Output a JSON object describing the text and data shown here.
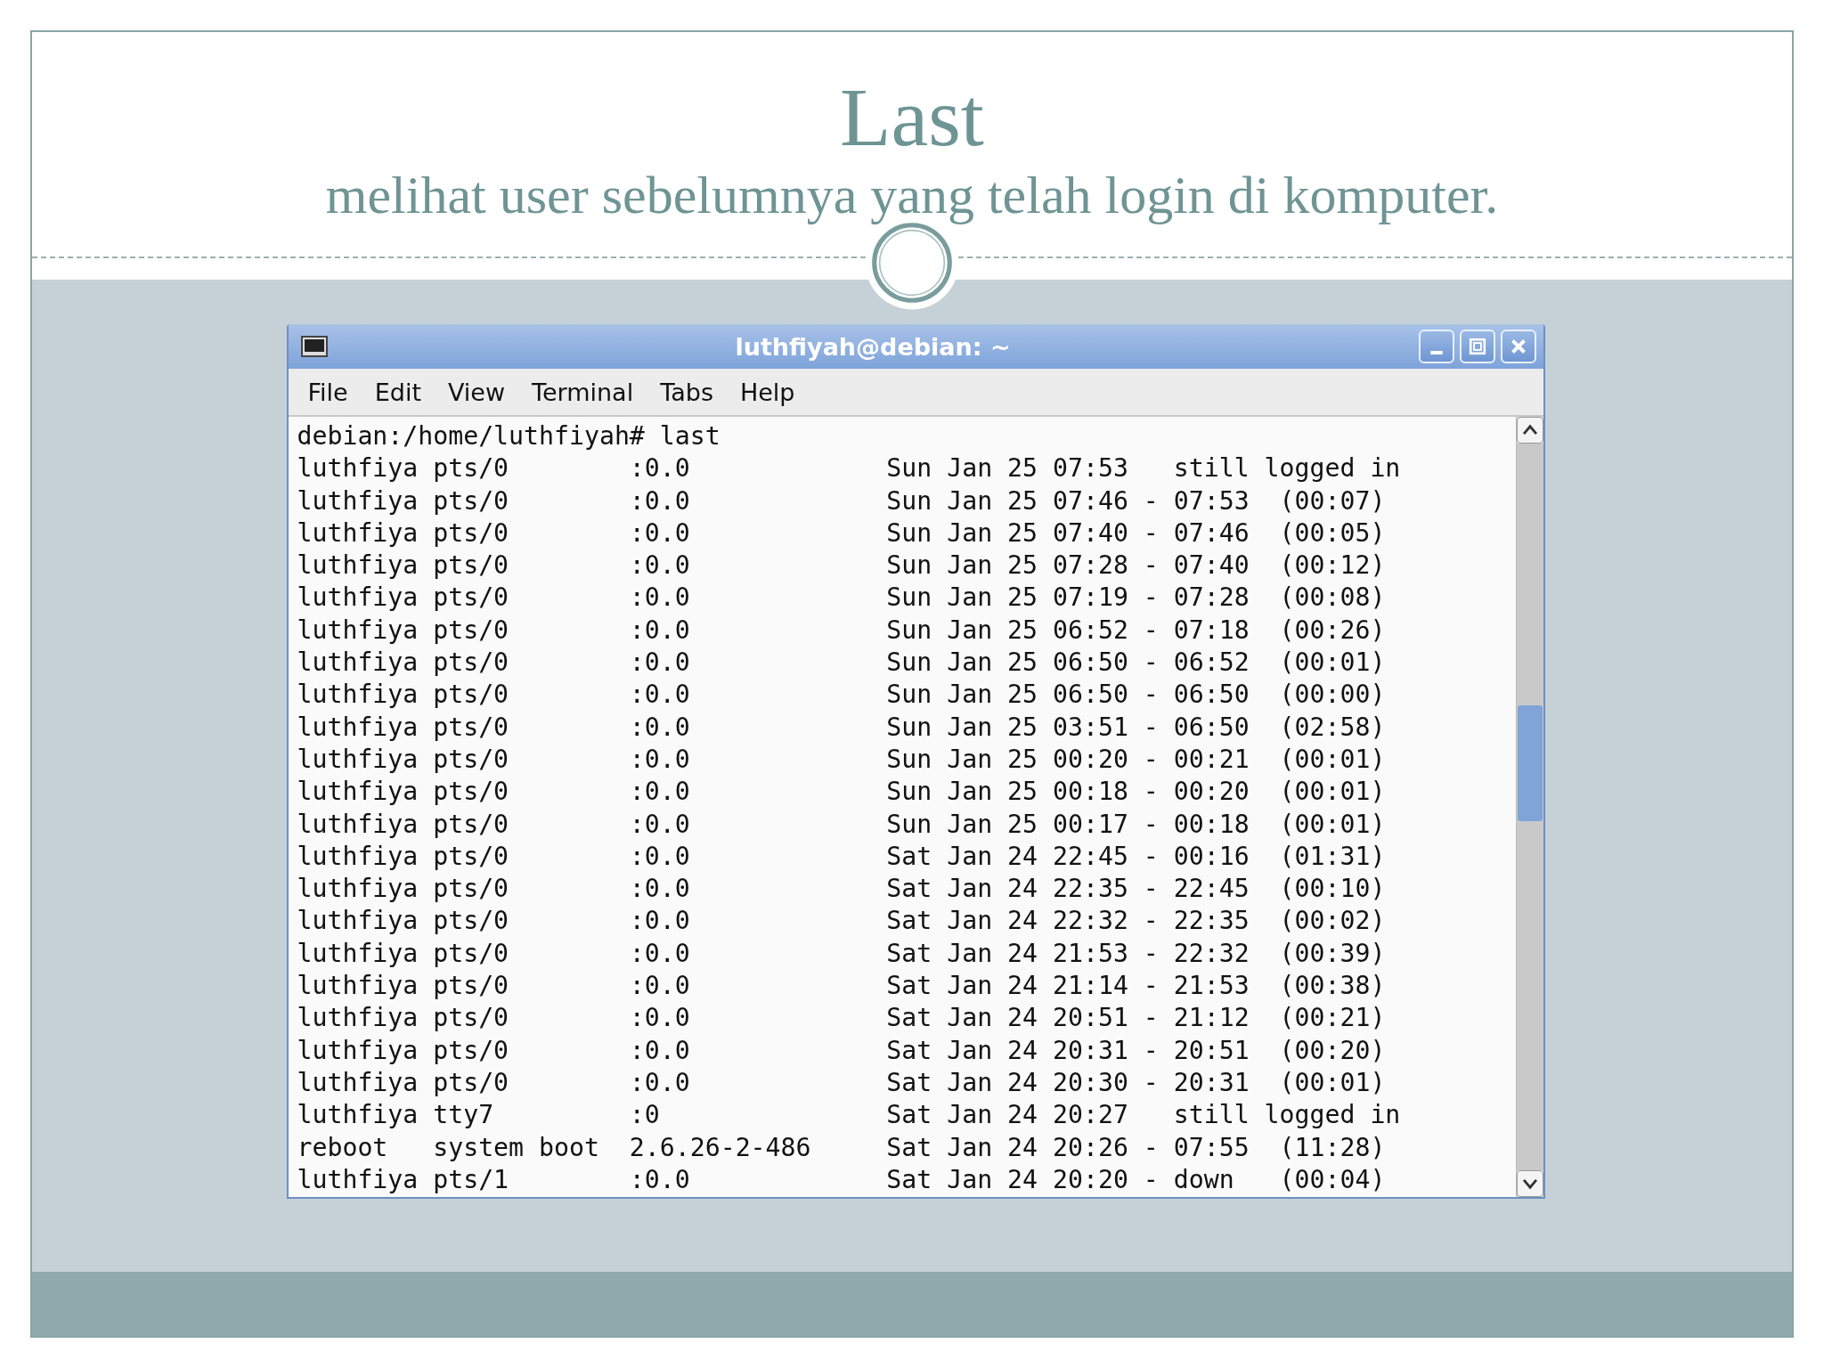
{
  "slide": {
    "title": "Last",
    "subtitle": "melihat user sebelumnya yang telah login di komputer."
  },
  "window": {
    "title": "luthfiyah@debian: ~"
  },
  "menu": [
    "File",
    "Edit",
    "View",
    "Terminal",
    "Tabs",
    "Help"
  ],
  "terminal_lines": [
    "debian:/home/luthfiyah# last",
    "luthfiya pts/0        :0.0             Sun Jan 25 07:53   still logged in",
    "luthfiya pts/0        :0.0             Sun Jan 25 07:46 - 07:53  (00:07)",
    "luthfiya pts/0        :0.0             Sun Jan 25 07:40 - 07:46  (00:05)",
    "luthfiya pts/0        :0.0             Sun Jan 25 07:28 - 07:40  (00:12)",
    "luthfiya pts/0        :0.0             Sun Jan 25 07:19 - 07:28  (00:08)",
    "luthfiya pts/0        :0.0             Sun Jan 25 06:52 - 07:18  (00:26)",
    "luthfiya pts/0        :0.0             Sun Jan 25 06:50 - 06:52  (00:01)",
    "luthfiya pts/0        :0.0             Sun Jan 25 06:50 - 06:50  (00:00)",
    "luthfiya pts/0        :0.0             Sun Jan 25 03:51 - 06:50  (02:58)",
    "luthfiya pts/0        :0.0             Sun Jan 25 00:20 - 00:21  (00:01)",
    "luthfiya pts/0        :0.0             Sun Jan 25 00:18 - 00:20  (00:01)",
    "luthfiya pts/0        :0.0             Sun Jan 25 00:17 - 00:18  (00:01)",
    "luthfiya pts/0        :0.0             Sat Jan 24 22:45 - 00:16  (01:31)",
    "luthfiya pts/0        :0.0             Sat Jan 24 22:35 - 22:45  (00:10)",
    "luthfiya pts/0        :0.0             Sat Jan 24 22:32 - 22:35  (00:02)",
    "luthfiya pts/0        :0.0             Sat Jan 24 21:53 - 22:32  (00:39)",
    "luthfiya pts/0        :0.0             Sat Jan 24 21:14 - 21:53  (00:38)",
    "luthfiya pts/0        :0.0             Sat Jan 24 20:51 - 21:12  (00:21)",
    "luthfiya pts/0        :0.0             Sat Jan 24 20:31 - 20:51  (00:20)",
    "luthfiya pts/0        :0.0             Sat Jan 24 20:30 - 20:31  (00:01)",
    "luthfiya tty7         :0               Sat Jan 24 20:27   still logged in",
    "reboot   system boot  2.6.26-2-486     Sat Jan 24 20:26 - 07:55  (11:28)",
    "luthfiya pts/1        :0.0             Sat Jan 24 20:20 - down   (00:04)"
  ]
}
